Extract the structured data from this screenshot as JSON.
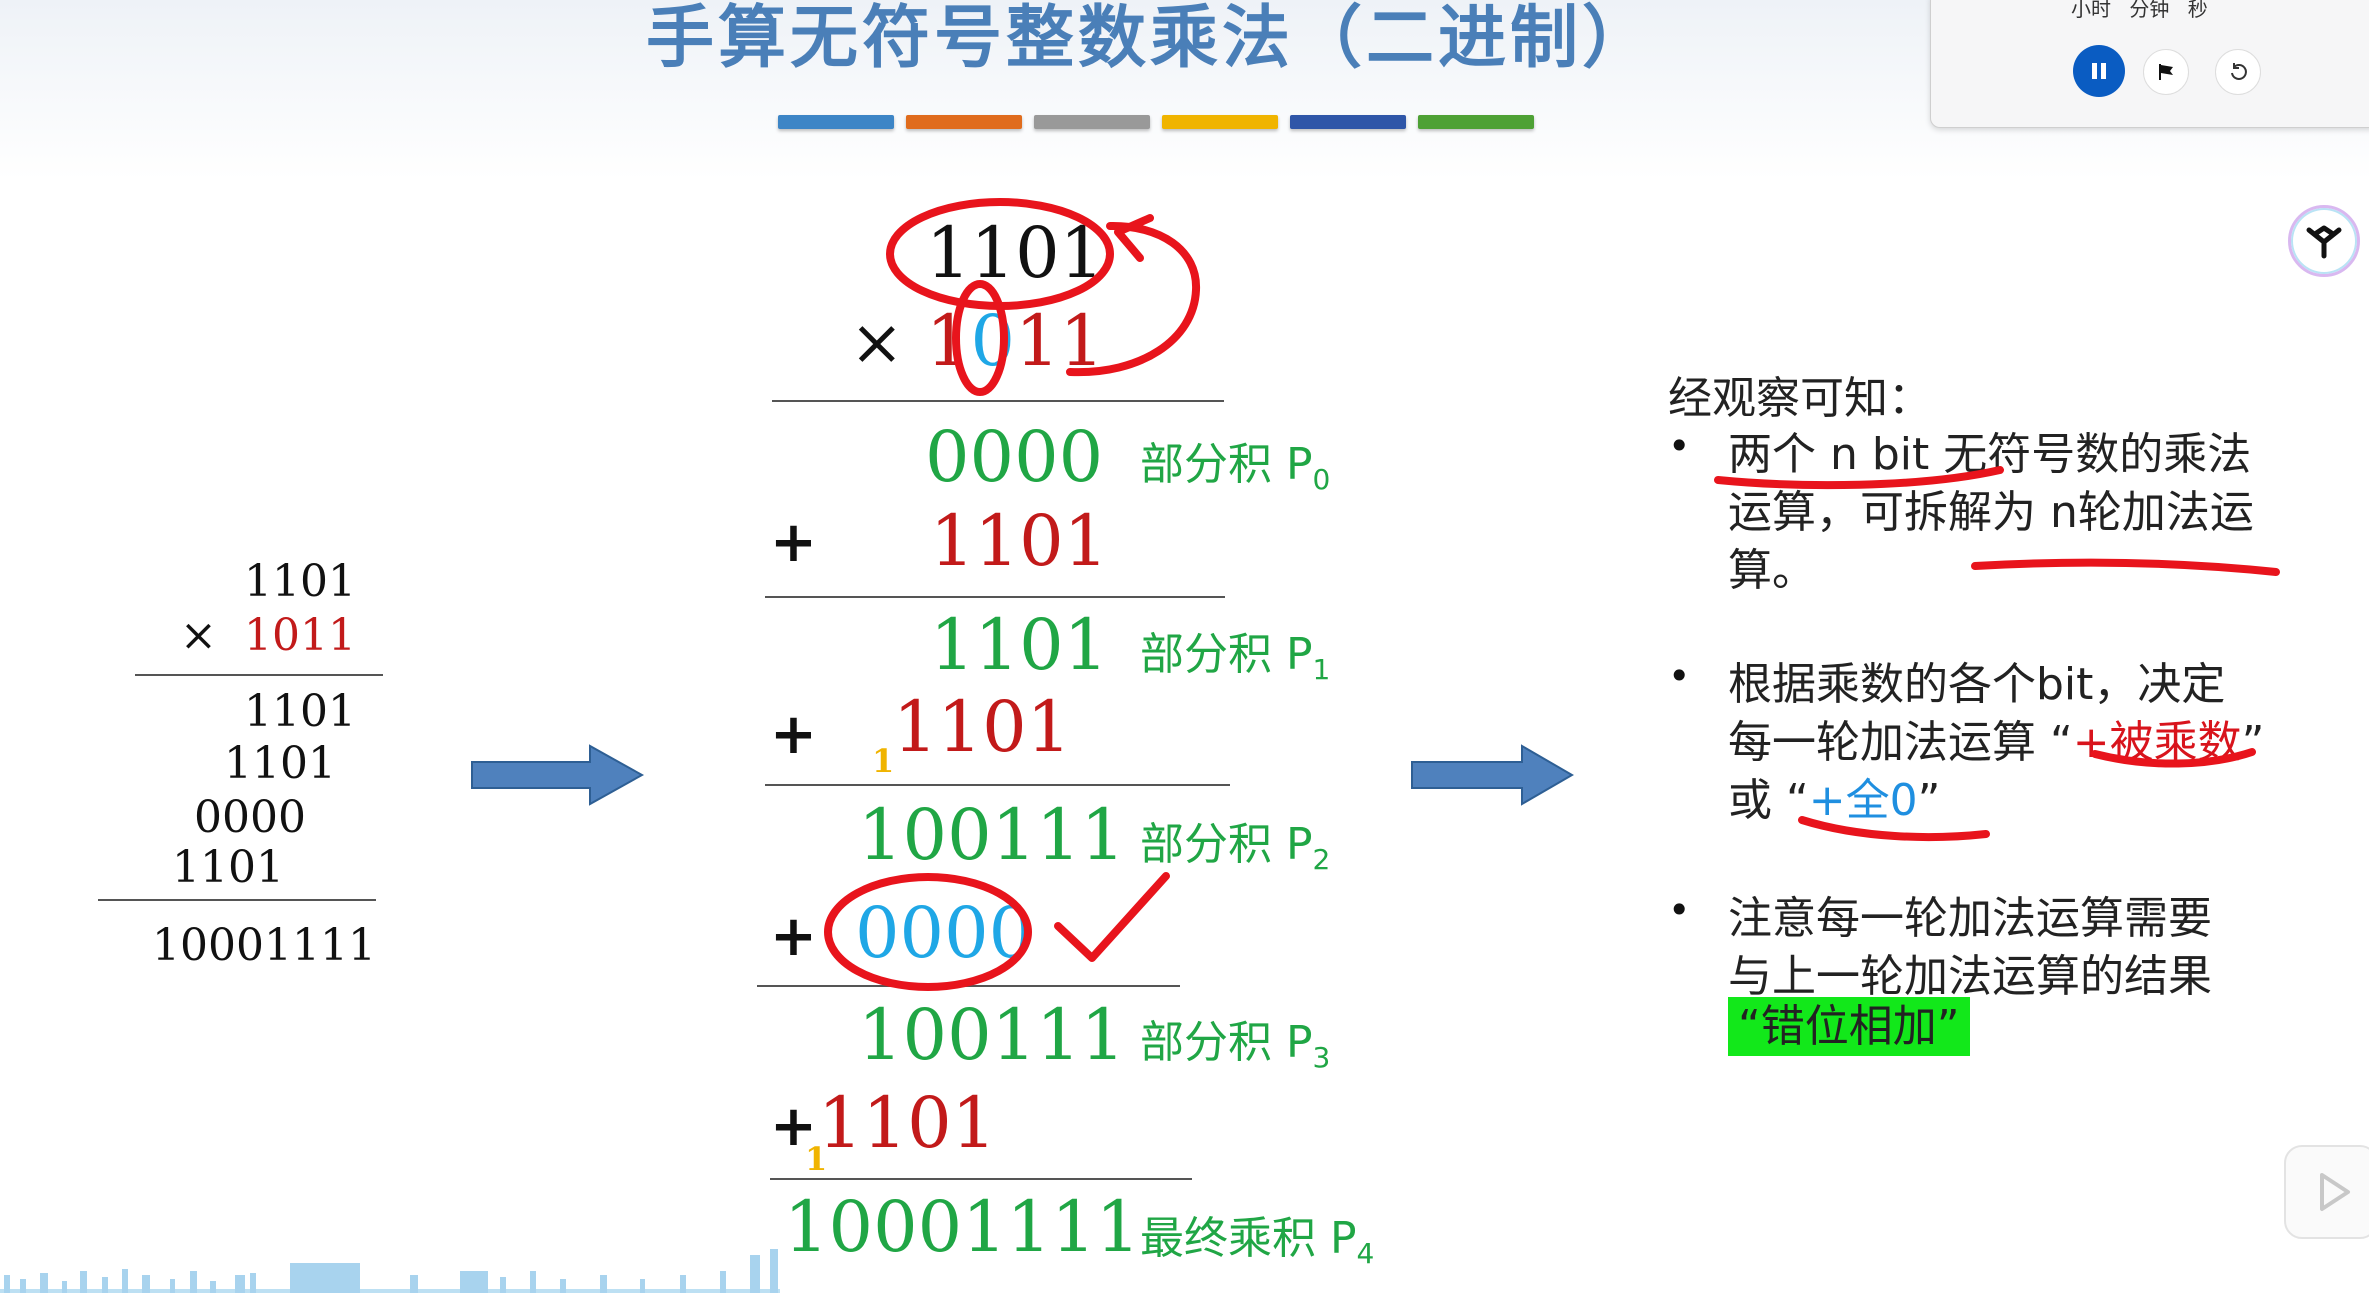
{
  "slide": {
    "title": "手算无符号整数乘法（二进制）",
    "color_bars": [
      "#3d85c6",
      "#e06c1d",
      "#999999",
      "#f0b400",
      "#2f56a8",
      "#4ea135"
    ]
  },
  "left_example": {
    "multiplicand": "1101",
    "times": "×",
    "multiplier": "1011",
    "partials": [
      "1101",
      "1101",
      "0000",
      "1101"
    ],
    "result": "10001111"
  },
  "middle": {
    "multiplicand": "1101",
    "times": "×",
    "multiplier": {
      "d1": "1",
      "d2": "0",
      "d3": "11"
    },
    "steps": [
      {
        "value": "0000",
        "label": "部分积",
        "sub": "0"
      },
      {
        "plus": "+",
        "value": "1101"
      },
      {
        "value": "1101",
        "label": "部分积",
        "sub": "1"
      },
      {
        "plus": "+",
        "carry": "1",
        "value": "1101"
      },
      {
        "value": "100111",
        "label": "部分积",
        "sub": "2"
      },
      {
        "plus": "+",
        "value": "0000"
      },
      {
        "value": "100111",
        "label": "部分积",
        "sub": "3"
      },
      {
        "plus": "+",
        "carry": "1",
        "value": "1101"
      },
      {
        "value": "10001111",
        "label": "最终乘积",
        "sub": "4"
      }
    ]
  },
  "right": {
    "heading": "经观察可知：",
    "bullet1": {
      "l1": "两个 n bit 无符号数的乘法",
      "l2": "运算，可拆解为 n轮加法运",
      "l3": "算。"
    },
    "bullet2": {
      "l1": "根据乘数的各个bit，决定",
      "l2a": "每一轮加法运算 “",
      "l2b": "+被乘数",
      "l2c": "”",
      "l3a": "或 “",
      "l3b": "+全0",
      "l3c": "”"
    },
    "bullet3": {
      "l1": "注意每一轮加法运算需要",
      "l2": "与上一轮加法运算的结果",
      "l3": "“错位相加”"
    },
    "bullet_symbol": "•"
  },
  "timer_panel": {
    "labels": "小时 分钟 秒",
    "pause_icon": "pause-icon",
    "flag_icon": "flag-icon",
    "reset_icon": "reset-icon"
  }
}
